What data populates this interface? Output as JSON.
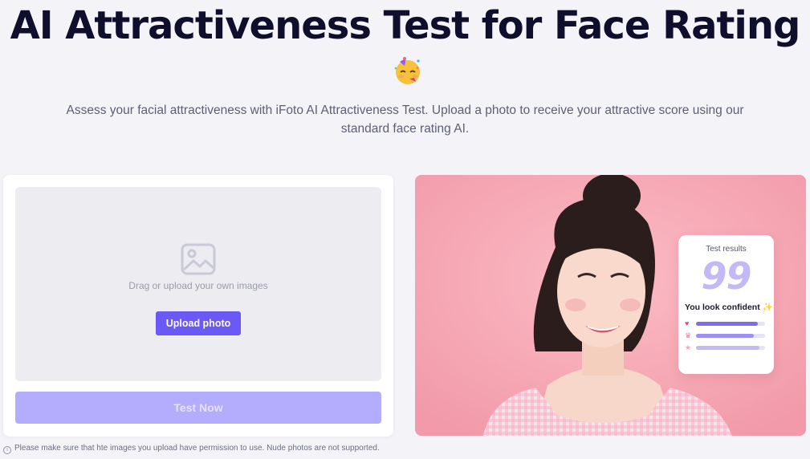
{
  "header": {
    "title": "AI Attractiveness Test for Face Rating",
    "emoji": "partying-face-icon",
    "subtitle": "Assess your facial attractiveness with iFoto AI Attractiveness Test. Upload a photo to receive your attractive score using our standard face rating AI."
  },
  "upload": {
    "drag_text": "Drag or upload your own images",
    "upload_label": "Upload photo",
    "test_label": "Test Now",
    "notice": "Please make sure that hte images you upload have permission to use. Nude photos are not supported."
  },
  "result_card": {
    "title": "Test results",
    "score": "99",
    "verdict": "You look confident",
    "metrics": [
      {
        "icon": "heart-icon",
        "color": "#e8477c",
        "fill": 0.9
      },
      {
        "icon": "crown-icon",
        "color": "#f07aa8",
        "fill": 0.84
      },
      {
        "icon": "star-icon",
        "color": "#f7a5c6",
        "fill": 0.92
      }
    ]
  },
  "colors": {
    "accent": "#6b59f5",
    "test_button": "#b4acfc",
    "photo_background": "#f6aab6",
    "score": "#c4b9f6"
  }
}
